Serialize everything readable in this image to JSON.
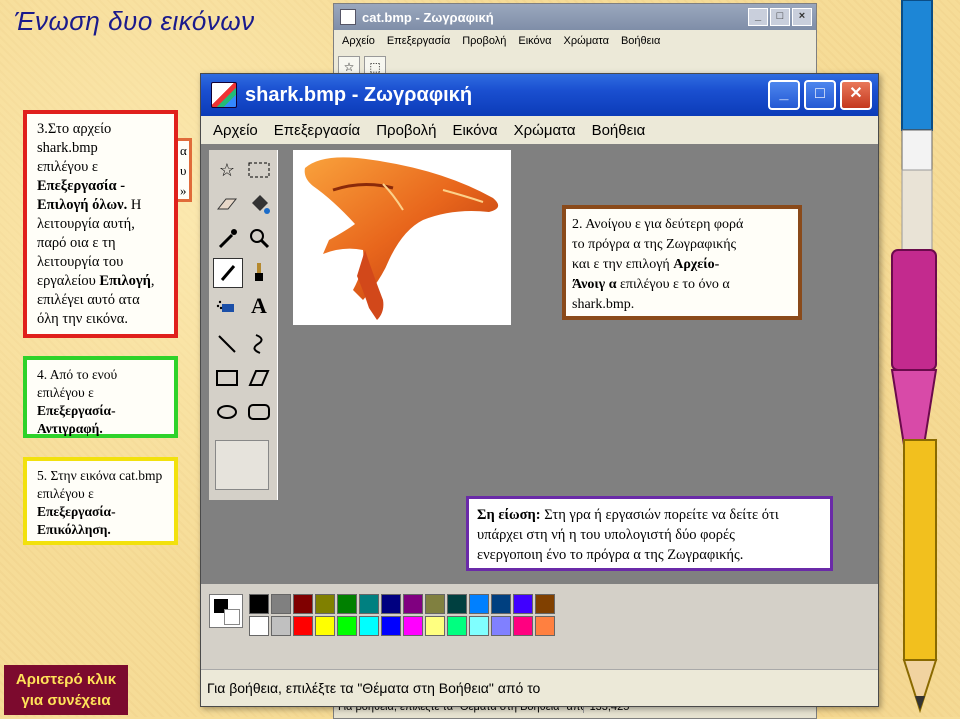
{
  "slide": {
    "title": "Ένωση δυο εικόνων"
  },
  "back_window": {
    "title": "cat.bmp - Ζωγραφική",
    "menu": [
      "Αρχείο",
      "Επεξεργασία",
      "Προβολή",
      "Εικόνα",
      "Χρώματα",
      "Βοήθεια"
    ],
    "status_text": "Για βοήθεια, επιλέξτε τα \"Θέματα στη Βοήθεια\" από το",
    "coords": "133,425"
  },
  "front_window": {
    "title": "shark.bmp - Ζωγραφική",
    "menu": [
      "Αρχείο",
      "Επεξεργασία",
      "Προβολή",
      "Εικόνα",
      "Χρώματα",
      "Βοήθεια"
    ],
    "status_text": "Για βοήθεια, επιλέξτε τα \"Θέματα στη Βοήθεια\" από το"
  },
  "callouts": {
    "step3": {
      "line1": "3.Στο αρχείο",
      "line2": "shark.bmp",
      "line3": "επιλέγου ε",
      "bold1": "Επεξεργασία -",
      "bold2": "Επιλογή όλων.",
      "rest_a": " Η",
      "rest_b": "λειτουργία αυτή,",
      "rest_c": "παρό οια  ε τη",
      "rest_d": "λειτουργία του",
      "rest_e": "εργαλείου ",
      "bold3": "Επιλογή",
      "rest_f": ",",
      "rest_g": "επιλέγει αυτό ατα",
      "rest_h": "όλη την εικόνα.",
      "tail": "α\nυ\n»"
    },
    "step4": {
      "line1": "4. Από το  ενού",
      "line2": "επιλέγου ε",
      "line3": "Επεξεργασία-",
      "line4": "Αντιγραφή."
    },
    "step5": {
      "line1": "5. Στην εικόνα cat.bmp",
      "line2": "επιλέγου ε",
      "line3": "Επεξεργασία-",
      "line4": "Επικόλληση."
    },
    "step2": {
      "line1": "2. Ανοίγου ε για δεύτερη φορά",
      "line2": "το πρόγρα  α της Ζωγραφικής",
      "line3a": "και  ε την επιλογή ",
      "line3b": "Αρχείο-",
      "line4a": "Άνοιγ α",
      "line4b": " επιλέγου ε το όνο α",
      "line5": "shark.bmp."
    },
    "note": {
      "label": "Ση είωση:",
      "text1": " Στη γρα  ή εργασιών  πορείτε να δείτε ότι",
      "text2": "υπάρχει στη  νή η του υπολογιστή δύο φορές",
      "text3": "ενεργοποιη ένο το πρόγρα  α της Ζωγραφικής."
    }
  },
  "next_button": {
    "line1": "Αριστερό κλικ",
    "line2": "για συνέχεια"
  },
  "colors": {
    "accent_red": "#e0201c",
    "accent_green": "#2ed22a",
    "accent_yellow": "#f2e10d",
    "accent_brown": "#8a4a1a",
    "accent_purple": "#6a2aa8",
    "titlebar_blue": "#0b3bb8",
    "next_button_bg": "#7c0a2e"
  },
  "icons": [
    "free-select-icon",
    "rect-select-icon",
    "eraser-icon",
    "fill-icon",
    "color-picker-icon",
    "magnifier-icon",
    "pencil-icon",
    "brush-icon",
    "airbrush-icon",
    "text-icon",
    "line-icon",
    "curve-icon",
    "rectangle-icon",
    "polygon-icon",
    "ellipse-icon",
    "rounded-rect-icon"
  ]
}
